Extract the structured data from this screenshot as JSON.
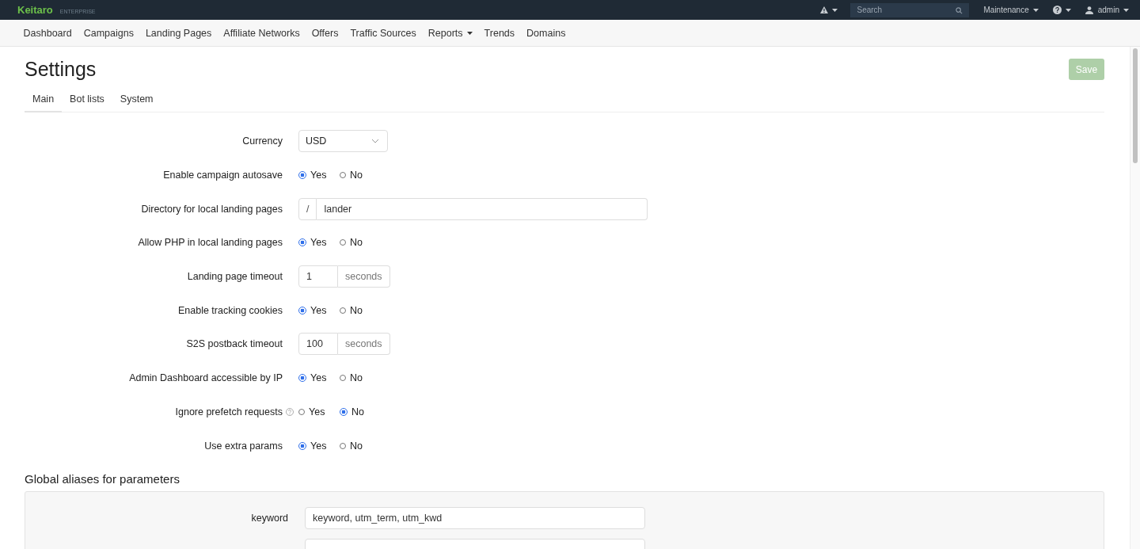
{
  "topbar": {
    "brand": "Keitaro",
    "edition": "ENTERPRISE",
    "search": {
      "placeholder": "Search"
    },
    "menus": [
      {
        "kind": "alert"
      },
      {
        "kind": "text",
        "label": "Maintenance"
      },
      {
        "kind": "help"
      },
      {
        "kind": "user",
        "label": "admin"
      }
    ]
  },
  "nav": [
    {
      "label": "Dashboard",
      "dropdown": false
    },
    {
      "label": "Campaigns",
      "dropdown": false
    },
    {
      "label": "Landing Pages",
      "dropdown": false
    },
    {
      "label": "Affiliate Networks",
      "dropdown": false
    },
    {
      "label": "Offers",
      "dropdown": false
    },
    {
      "label": "Traffic Sources",
      "dropdown": false
    },
    {
      "label": "Reports",
      "dropdown": true
    },
    {
      "label": "Trends",
      "dropdown": false
    },
    {
      "label": "Domains",
      "dropdown": false
    }
  ],
  "page": {
    "title": "Settings",
    "save_button": {
      "label": "Save",
      "disabled": true
    }
  },
  "tabs": [
    {
      "label": "Main",
      "selected": true
    },
    {
      "label": "Bot lists",
      "selected": false
    },
    {
      "label": "System",
      "selected": false
    }
  ],
  "fields": [
    {
      "kind": "select",
      "label": "Currency",
      "value": "USD",
      "help": false
    },
    {
      "kind": "radio",
      "label": "Enable campaign autosave",
      "help": false,
      "options": [
        {
          "label": "Yes",
          "selected": true
        },
        {
          "label": "No",
          "selected": false
        }
      ]
    },
    {
      "kind": "prefix",
      "label": "Directory for local landing pages",
      "prefix": "/",
      "value": "lander",
      "help": false
    },
    {
      "kind": "radio",
      "label": "Allow PHP in local landing pages",
      "help": false,
      "options": [
        {
          "label": "Yes",
          "selected": true
        },
        {
          "label": "No",
          "selected": false
        }
      ]
    },
    {
      "kind": "suffix",
      "label": "Landing page timeout",
      "value": "1",
      "suffix": "seconds",
      "help": false
    },
    {
      "kind": "radio",
      "label": "Enable tracking cookies",
      "help": false,
      "options": [
        {
          "label": "Yes",
          "selected": true
        },
        {
          "label": "No",
          "selected": false
        }
      ]
    },
    {
      "kind": "suffix",
      "label": "S2S postback timeout",
      "value": "100",
      "suffix": "seconds",
      "help": false
    },
    {
      "kind": "radio",
      "label": "Admin Dashboard accessible by IP",
      "help": false,
      "options": [
        {
          "label": "Yes",
          "selected": true
        },
        {
          "label": "No",
          "selected": false
        }
      ]
    },
    {
      "kind": "radio",
      "label": "Ignore prefetch requests",
      "help": true,
      "options": [
        {
          "label": "Yes",
          "selected": false
        },
        {
          "label": "No",
          "selected": true
        }
      ]
    },
    {
      "kind": "radio",
      "label": "Use extra params",
      "help": false,
      "options": [
        {
          "label": "Yes",
          "selected": true
        },
        {
          "label": "No",
          "selected": false
        }
      ]
    }
  ],
  "aliases": {
    "title": "Global aliases for parameters",
    "rows": [
      {
        "kind": "input",
        "label": "keyword",
        "value": "keyword, utm_term, utm_kwd"
      },
      {
        "kind": "input"
      }
    ]
  }
}
